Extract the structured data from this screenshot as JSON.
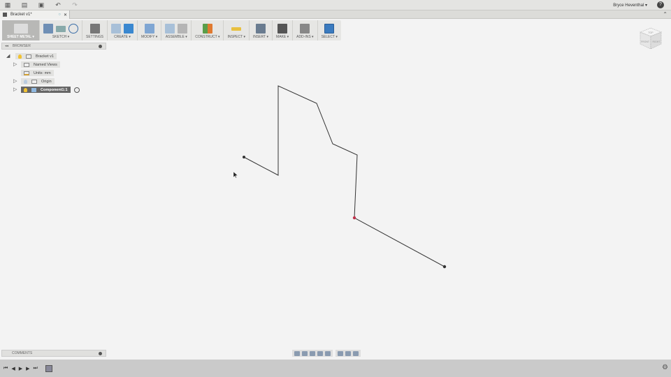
{
  "topbar": {
    "user": "Bryce Heventhal ▾",
    "help": "?"
  },
  "document_tab": {
    "title": "Bracket v1*"
  },
  "toolbar": {
    "groups": [
      "SHEET METAL ▾",
      "SKETCH ▾",
      "SETTINGS",
      "CREATE ▾",
      "MODIFY ▾",
      "ASSEMBLE ▾",
      "CONSTRUCT ▾",
      "INSPECT ▾",
      "INSERT ▾",
      "MAKE ▾",
      "ADD-INS ▾",
      "SELECT ▾"
    ]
  },
  "browser": {
    "title": "BROWSER",
    "nodes": [
      "Bracket v1",
      "Named Views",
      "Units: mm",
      "Origin",
      "Component1:1"
    ]
  },
  "comments": {
    "title": "COMMENTS"
  },
  "viewcube": {
    "faces": [
      "TOP",
      "FRONT",
      "RIGHT"
    ]
  },
  "colors": {
    "selected_point": "#c0304a",
    "select_accent": "#3b7bbf"
  }
}
